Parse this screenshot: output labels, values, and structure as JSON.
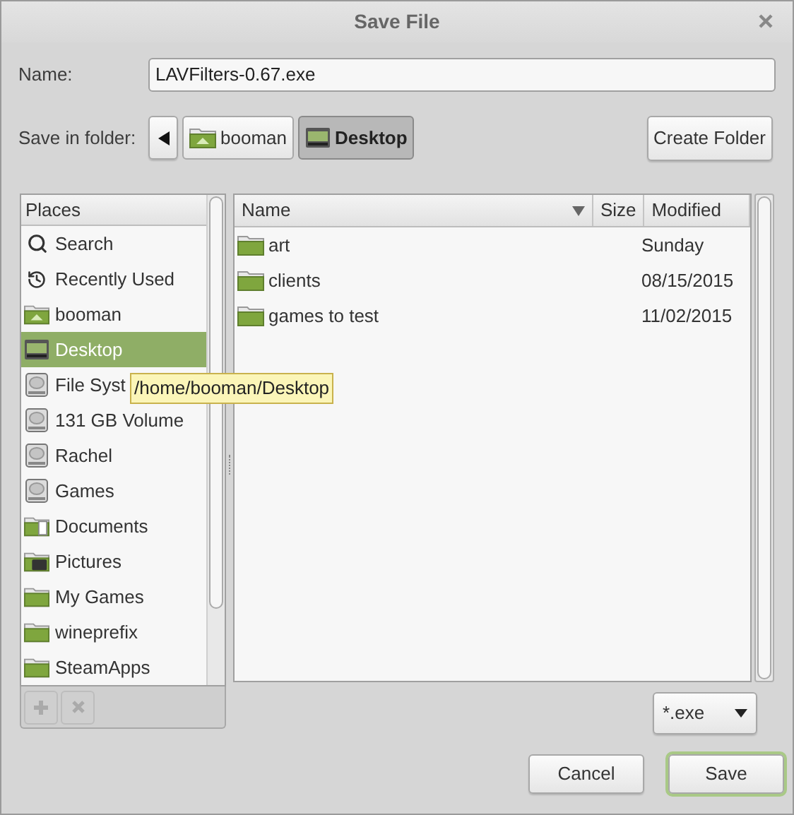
{
  "window": {
    "title": "Save File"
  },
  "name_field": {
    "label": "Name:",
    "value": "LAVFilters-0.67.exe"
  },
  "folder_bar": {
    "label": "Save in folder:",
    "crumbs": [
      {
        "label": "booman",
        "kind": "home",
        "selected": false
      },
      {
        "label": "Desktop",
        "kind": "desktop",
        "selected": true
      }
    ],
    "create_button": "Create Folder"
  },
  "places": {
    "header": "Places",
    "items": [
      {
        "label": "Search",
        "kind": "search",
        "selected": false
      },
      {
        "label": "Recently Used",
        "kind": "recent",
        "selected": false
      },
      {
        "label": "booman",
        "kind": "home",
        "selected": false
      },
      {
        "label": "Desktop",
        "kind": "desktop",
        "selected": true
      },
      {
        "label": "File Syst",
        "kind": "drive",
        "selected": false
      },
      {
        "label": "131 GB Volume",
        "kind": "drive",
        "selected": false
      },
      {
        "label": "Rachel",
        "kind": "drive",
        "selected": false
      },
      {
        "label": "Games",
        "kind": "drive",
        "selected": false
      },
      {
        "label": "Documents",
        "kind": "documents",
        "selected": false
      },
      {
        "label": "Pictures",
        "kind": "pictures",
        "selected": false
      },
      {
        "label": "My Games",
        "kind": "folder",
        "selected": false
      },
      {
        "label": "wineprefix",
        "kind": "folder",
        "selected": false
      },
      {
        "label": "SteamApps",
        "kind": "folder",
        "selected": false
      }
    ],
    "add_disabled": true,
    "remove_disabled": true
  },
  "tooltip": "/home/booman/Desktop",
  "files": {
    "columns": [
      {
        "label": "Name",
        "sorted": true
      },
      {
        "label": "Size",
        "sorted": false
      },
      {
        "label": "Modified",
        "sorted": false
      }
    ],
    "rows": [
      {
        "name": "art",
        "size": "",
        "modified": "Sunday"
      },
      {
        "name": "clients",
        "modified": "08/15/2015"
      },
      {
        "name": "games to test",
        "modified": "11/02/2015"
      }
    ]
  },
  "filter": {
    "value": "*.exe"
  },
  "buttons": [
    {
      "label": "Cancel",
      "default": false
    },
    {
      "label": "Save",
      "default": true
    }
  ]
}
